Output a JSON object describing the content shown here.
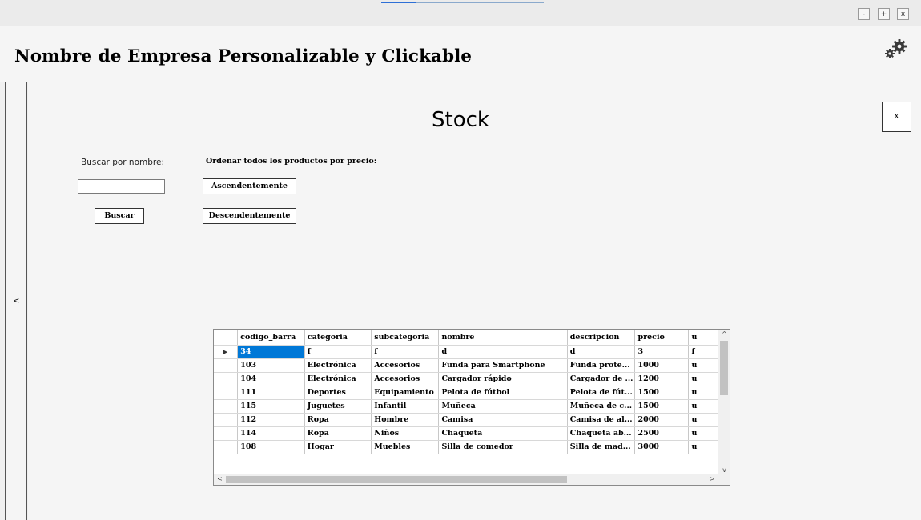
{
  "window": {
    "minimize_label": "-",
    "maximize_label": "+",
    "close_label": "x",
    "accent_color": "#2d6fd6"
  },
  "header": {
    "company_name": "Nombre de Empresa Personalizable y Clickable",
    "settings_icon": "gears-icon"
  },
  "sidebar": {
    "toggle_label": "<"
  },
  "main": {
    "title": "Stock",
    "close_label": "x",
    "search": {
      "label": "Buscar por nombre:",
      "value": "",
      "button_label": "Buscar"
    },
    "sort": {
      "label": "Ordenar todos los productos por precio:",
      "ascending_label": "Ascendentemente",
      "descending_label": "Descendentemente"
    }
  },
  "grid": {
    "columns": [
      "codigo_barra",
      "categoria",
      "subcategoria",
      "nombre",
      "descripcion",
      "precio",
      "u"
    ],
    "selected_row": 0,
    "selection_color": "#0078d7",
    "rows": [
      [
        "34",
        "f",
        "f",
        "d",
        "d",
        "3",
        "f"
      ],
      [
        "103",
        "Electrónica",
        "Accesorios",
        "Funda para Smartphone",
        "Funda prote...",
        "1000",
        "u"
      ],
      [
        "104",
        "Electrónica",
        "Accesorios",
        "Cargador rápido",
        "Cargador de ...",
        "1200",
        "u"
      ],
      [
        "111",
        "Deportes",
        "Equipamiento",
        "Pelota de fútbol",
        "Pelota de fút...",
        "1500",
        "u"
      ],
      [
        "115",
        "Juguetes",
        "Infantil",
        "Muñeca",
        "Muñeca de c...",
        "1500",
        "u"
      ],
      [
        "112",
        "Ropa",
        "Hombre",
        "Camisa",
        "Camisa de al...",
        "2000",
        "u"
      ],
      [
        "114",
        "Ropa",
        "Niños",
        "Chaqueta",
        "Chaqueta ab...",
        "2500",
        "u"
      ],
      [
        "108",
        "Hogar",
        "Muebles",
        "Silla de comedor",
        "Silla de mad...",
        "3000",
        "u"
      ]
    ],
    "scroll_up_icon": "^",
    "scroll_down_icon": "v",
    "scroll_left_icon": "<",
    "scroll_right_icon": ">"
  }
}
